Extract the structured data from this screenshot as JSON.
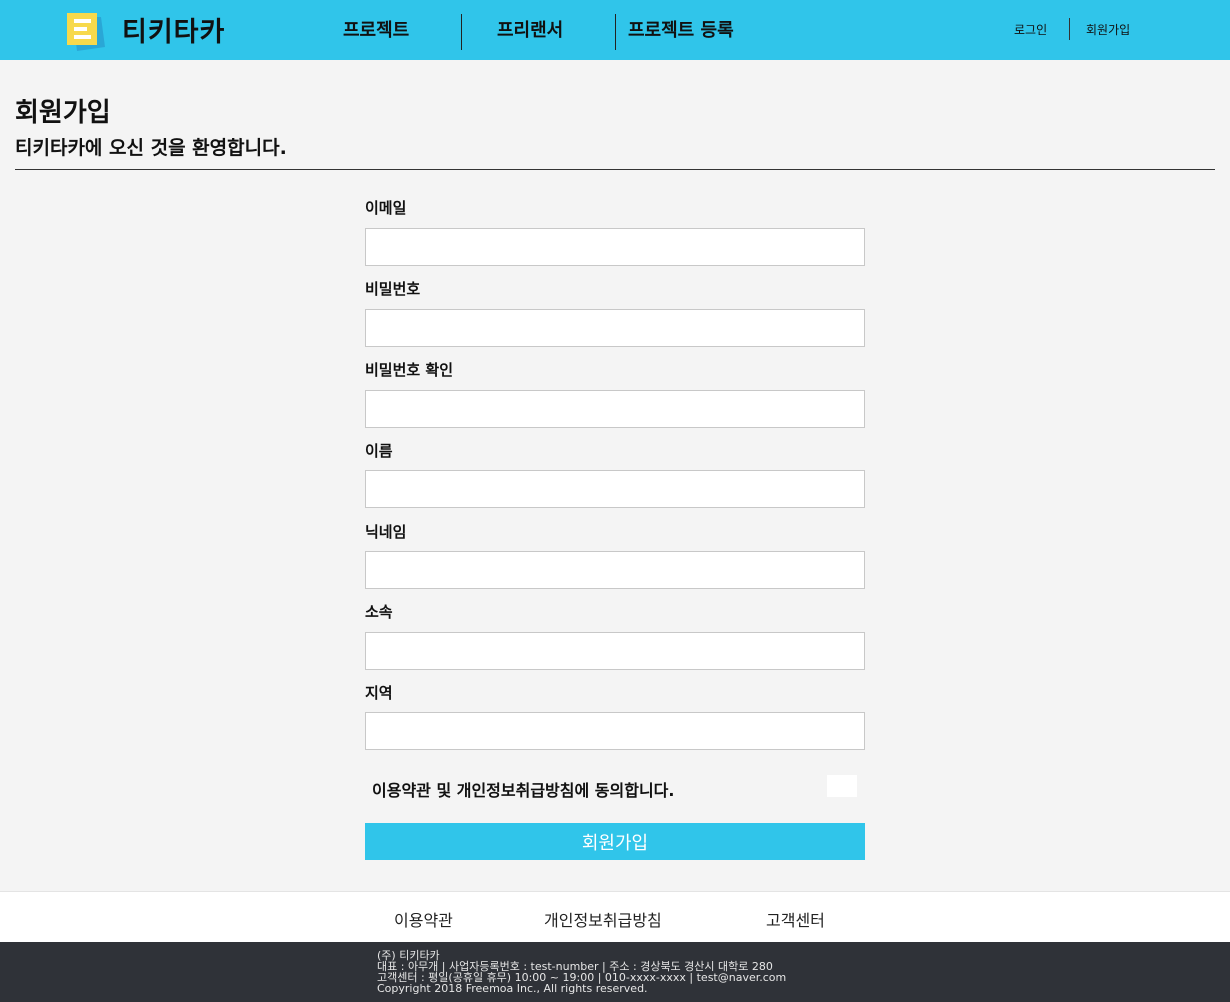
{
  "header": {
    "brand": "티키타카",
    "logo_icon": "logo-e-icon",
    "nav": [
      "프로젝트",
      "프리랜서",
      "프로젝트 등록"
    ],
    "auth": {
      "login": "로그인",
      "signup": "회원가입"
    },
    "colors": {
      "header_bg": "#30c5ea",
      "logo_yellow": "#f7d94c",
      "logo_blue": "#2aa7d6"
    }
  },
  "page": {
    "title": "회원가입",
    "subtitle": "티키타카에 오신 것을 환영합니다."
  },
  "form": {
    "fields": [
      {
        "label": "이메일",
        "value": ""
      },
      {
        "label": "비밀번호",
        "value": ""
      },
      {
        "label": "비밀번호 확인",
        "value": ""
      },
      {
        "label": "이름",
        "value": ""
      },
      {
        "label": "닉네임",
        "value": ""
      },
      {
        "label": "소속",
        "value": ""
      },
      {
        "label": "지역",
        "value": ""
      }
    ],
    "agreement": "이용약관 및 개인정보취급방침에 동의합니다.",
    "agreement_checked": false,
    "submit_label": "회원가입",
    "accent_color": "#30c5ea"
  },
  "footer": {
    "links": [
      "이용약관",
      "개인정보취급방침",
      "고객센터"
    ],
    "info": [
      "(주) 티키타카",
      "대표 : 아무개 | 사업자등록번호 : test-number | 주소 : 경상북도 경산시 대학로 280",
      "고객센터 : 평일(공휴일 휴무) 10:00 ~ 19:00 | 010-xxxx-xxxx | test@naver.com",
      "Copyright 2018 Freemoa Inc., All rights reserved."
    ],
    "dark_bg": "#2f3238"
  }
}
